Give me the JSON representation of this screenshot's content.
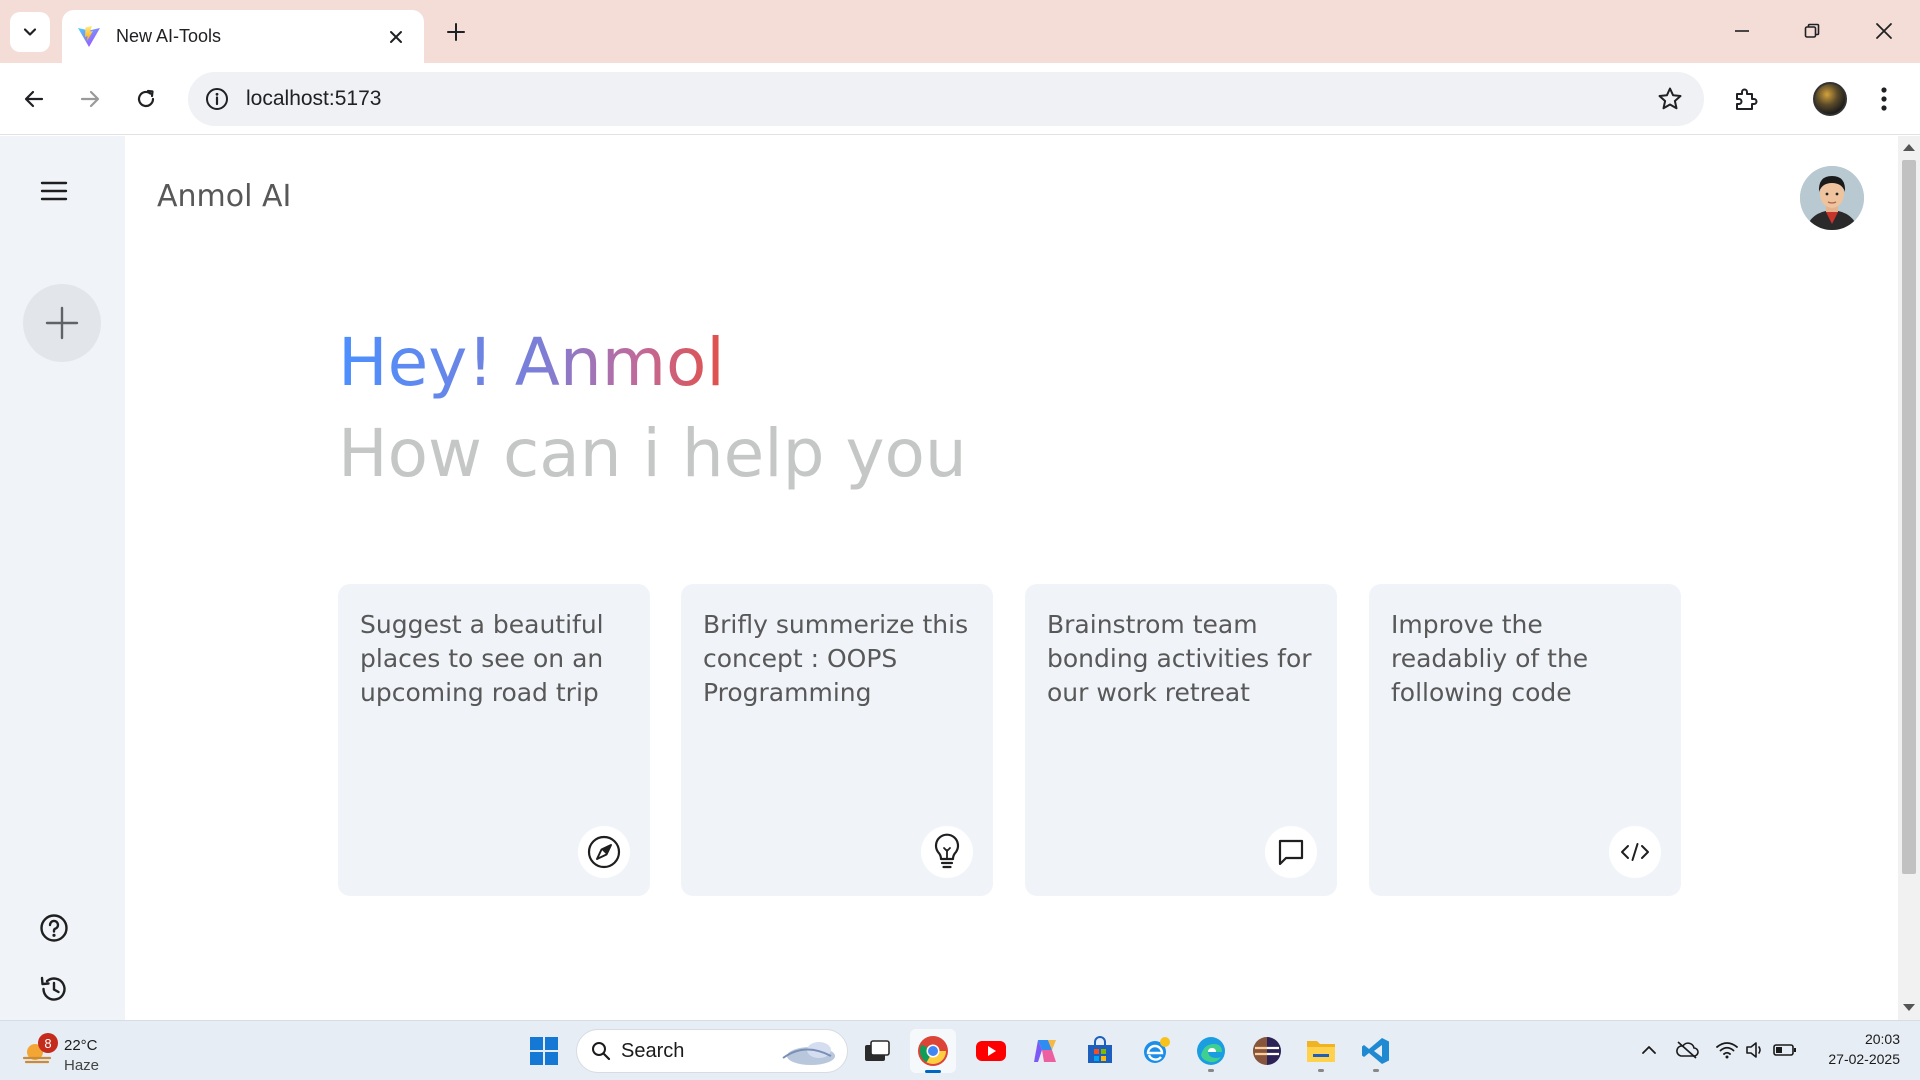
{
  "browser": {
    "tab_title": "New AI-Tools",
    "url": "localhost:5173"
  },
  "app": {
    "brand": "Anmol AI",
    "greeting": "Hey! Anmol",
    "subtitle": "How can i help you",
    "cards": [
      {
        "text": "Suggest a beautiful places to see on an upcoming road trip",
        "icon": "compass-icon"
      },
      {
        "text": "Brifly summerize this concept : OOPS Programming",
        "icon": "bulb-icon"
      },
      {
        "text": "Brainstrom team bonding activities for our work retreat",
        "icon": "message-icon"
      },
      {
        "text": "Improve the readabliy of the following code",
        "icon": "code-icon"
      }
    ],
    "colors": {
      "gradient_start": "#4b90ff",
      "gradient_end": "#e0524c",
      "subtitle": "#c4c7c5",
      "card_bg": "#f0f4f9"
    }
  },
  "taskbar": {
    "weather_badge": "8",
    "temperature": "22°C",
    "condition": "Haze",
    "search_label": "Search",
    "time": "20:03",
    "date": "27-02-2025"
  }
}
